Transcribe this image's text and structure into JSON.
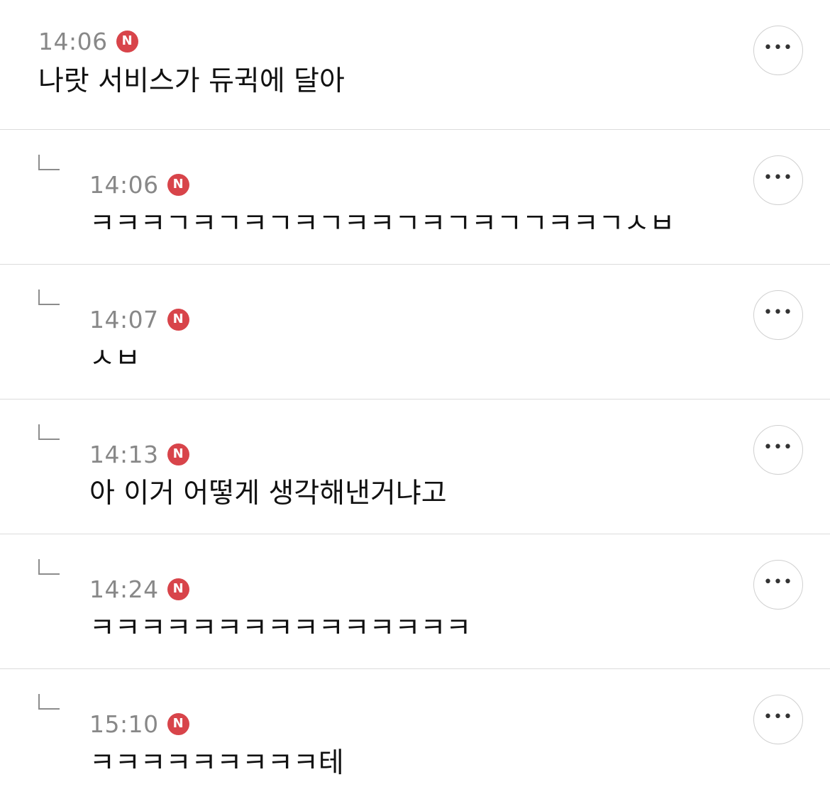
{
  "comments": [
    {
      "time": "14:06",
      "badge": "N",
      "text": "나랏 서비스가 듀귁에 달아",
      "is_reply": false,
      "more_icon": "more-horizontal-icon"
    },
    {
      "time": "14:06",
      "badge": "N",
      "text": "ㅋㅋㅋㄱㅋㄱㅋㄱㅋㄱㅋㅋㄱㅋㄱㅋㄱㄱㅋㅋㄱㅅㅂ",
      "is_reply": true,
      "more_icon": "more-horizontal-icon"
    },
    {
      "time": "14:07",
      "badge": "N",
      "text": "ㅅㅂ",
      "is_reply": true,
      "more_icon": "more-horizontal-icon"
    },
    {
      "time": "14:13",
      "badge": "N",
      "text": "아 이거 어떻게 생각해낸거냐고",
      "is_reply": true,
      "more_icon": "more-horizontal-icon"
    },
    {
      "time": "14:24",
      "badge": "N",
      "text": "ㅋㅋㅋㅋㅋㅋㅋㅋㅋㅋㅋㅋㅋㅋㅋ",
      "is_reply": true,
      "more_icon": "more-horizontal-icon"
    },
    {
      "time": "15:10",
      "badge": "N",
      "text": "ㅋㅋㅋㅋㅋㅋㅋㅋㅋ테",
      "is_reply": true,
      "more_icon": "more-horizontal-icon"
    }
  ],
  "colors": {
    "badge": "#d8444a",
    "time": "#888888",
    "text": "#111111",
    "divider": "#dcdcdc"
  }
}
